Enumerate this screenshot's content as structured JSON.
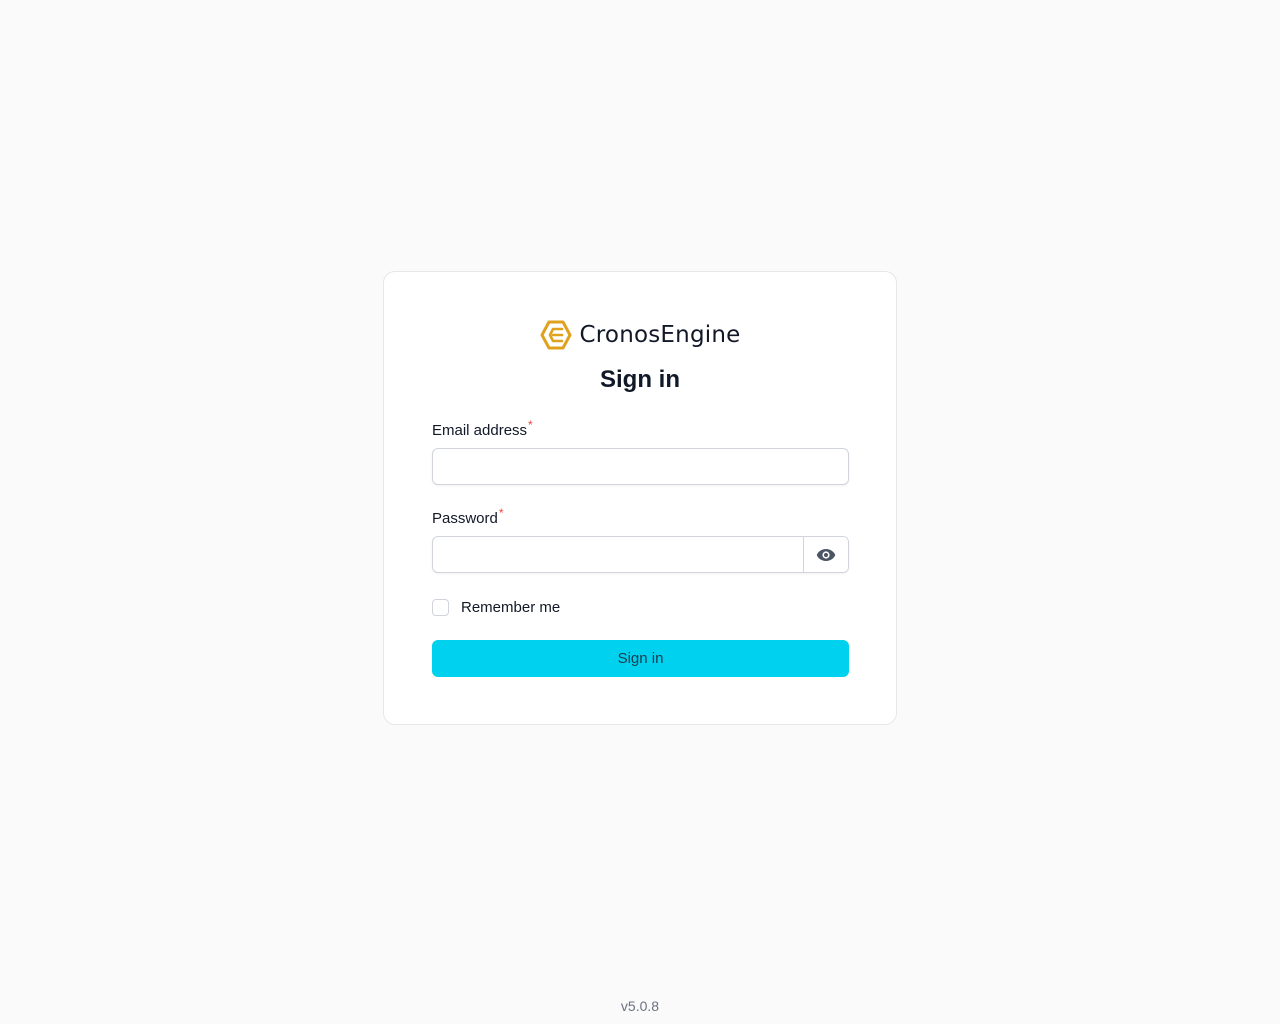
{
  "brand": {
    "name": "CronosEngine",
    "logo_icon": "hexagon-e-logo-icon",
    "logo_color": "#E0A21E"
  },
  "form": {
    "title": "Sign in",
    "email": {
      "label": "Email address",
      "required_marker": "*",
      "value": "",
      "placeholder": ""
    },
    "password": {
      "label": "Password",
      "required_marker": "*",
      "value": "",
      "placeholder": "",
      "toggle_icon": "eye-icon"
    },
    "remember": {
      "label": "Remember me",
      "checked": false
    },
    "submit_label": "Sign in",
    "accent_color": "#00D1EF"
  },
  "footer": {
    "version": "v5.0.8"
  }
}
